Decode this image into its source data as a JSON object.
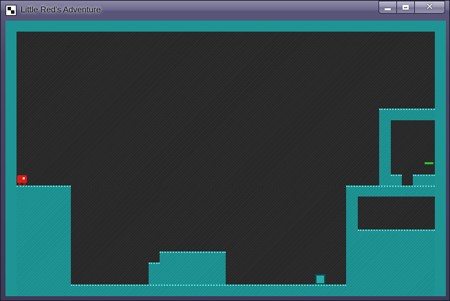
{
  "window": {
    "title": "Little Red's Adventure",
    "icon": "app-icon",
    "controls": {
      "minimize": "minimize-icon",
      "maximize": "maximize-icon",
      "close": "close-icon"
    }
  },
  "game": {
    "player": {
      "name": "little-red",
      "color": "#e01a14"
    },
    "wall_color": "#1d9191",
    "background_color": "#2c2c2c",
    "goal_color": "#2fc22f"
  }
}
